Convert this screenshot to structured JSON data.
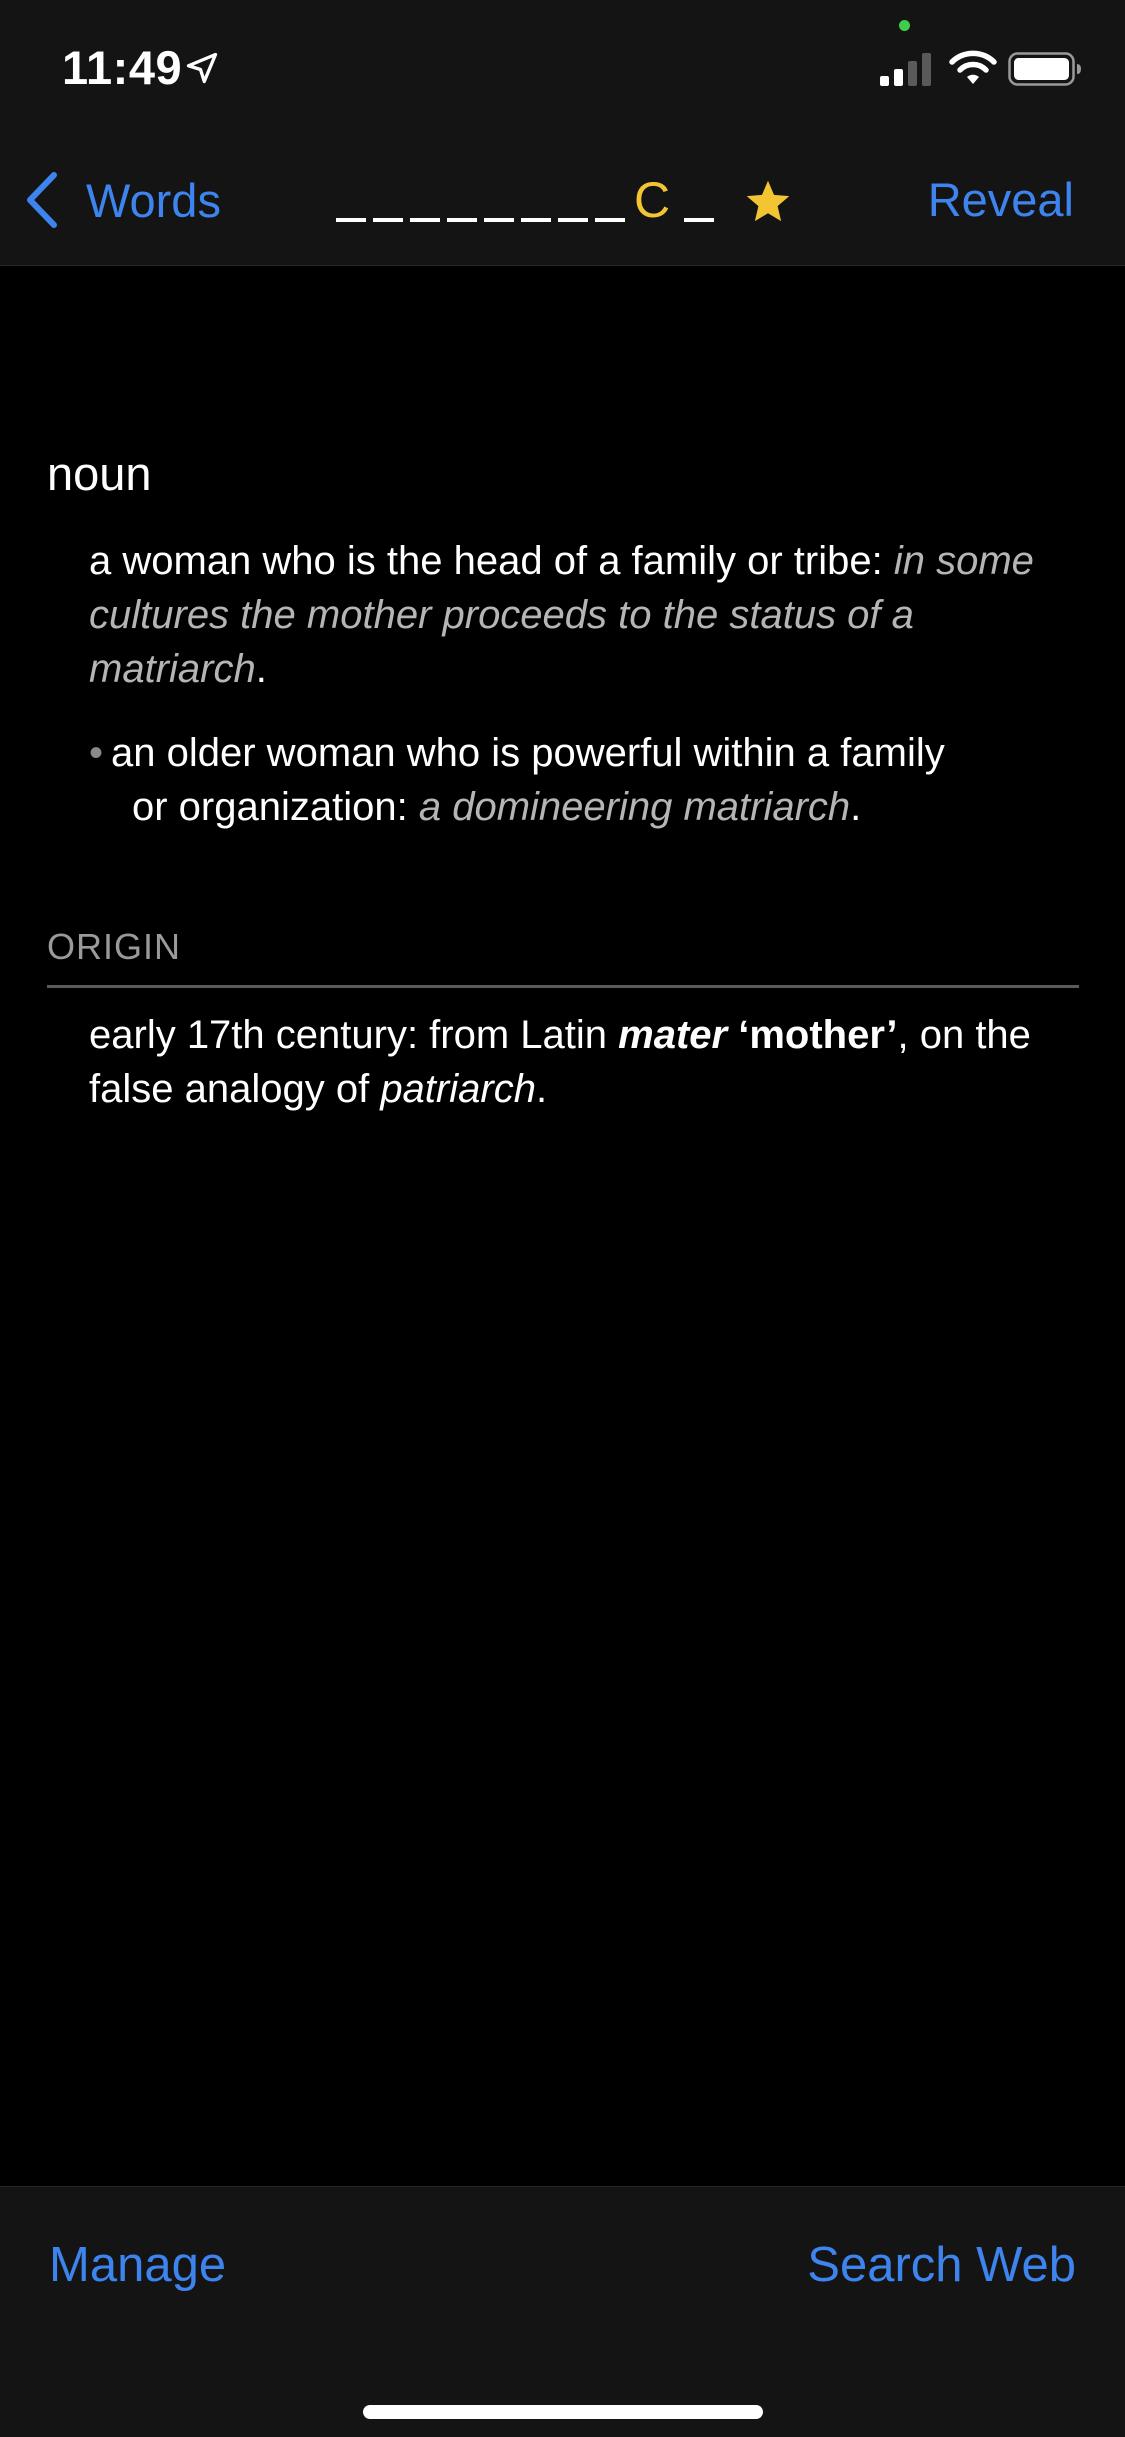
{
  "status_bar": {
    "time": "11:49",
    "location_icon": "location-arrow-icon",
    "signal_icon": "cellular-signal-icon",
    "wifi_icon": "wifi-icon",
    "battery_icon": "battery-icon"
  },
  "nav": {
    "back_label": "Words",
    "back_icon": "chevron-left-icon",
    "title_blanks_before": 8,
    "title_revealed_letter": "C",
    "title_blanks_after": 1,
    "favorite_icon": "star-icon",
    "reveal_label": "Reveal"
  },
  "entry": {
    "part_of_speech": "noun",
    "definitions": [
      {
        "text": "a woman who is the head of a family or tribe: ",
        "example": "in some cultures the mother proceeds to the status of a matriarch",
        "end": "."
      },
      {
        "bullet": "•",
        "text_line1": "an older woman who is powerful within a family",
        "text_line2": "or organization: ",
        "example": "a domineering matriarch",
        "end": "."
      }
    ],
    "origin": {
      "header": "ORIGIN",
      "part1": "early 17th century: from Latin ",
      "latin_word": "mater",
      "gloss": " ‘mother’",
      "part2": ", on the false analogy of ",
      "analogy_word": "patriarch",
      "end": "."
    }
  },
  "toolbar": {
    "manage_label": "Manage",
    "search_label": "Search Web"
  },
  "colors": {
    "accent": "#3d84ee",
    "revealed_letter": "#f4c533",
    "star": "#f4c533",
    "background": "#000000",
    "bar_background": "#141414"
  }
}
